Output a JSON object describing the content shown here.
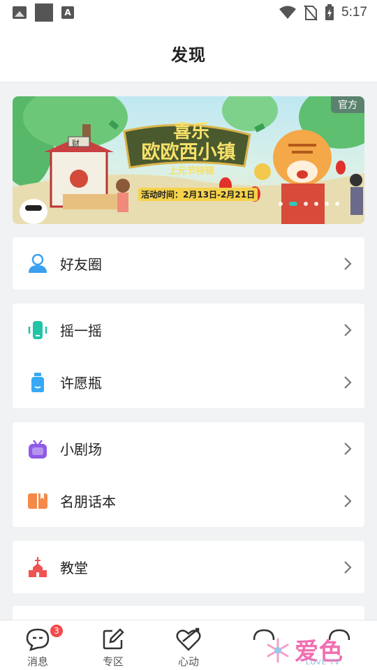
{
  "status_bar": {
    "time": "5:17",
    "icons": [
      "image-icon",
      "square-icon",
      "a-icon",
      "wifi-icon",
      "no-sim-icon",
      "battery-charging-icon"
    ]
  },
  "header": {
    "title": "发现"
  },
  "banner": {
    "badge": "官方",
    "title_line1": "喜乐",
    "title_line2": "欧欧西小镇",
    "subtitle": "上元节特辑",
    "activity_time": "活动时间：2月13日-2月21日",
    "sign": "财",
    "dot_count": 6,
    "active_dot": 1
  },
  "menu_groups": [
    {
      "items": [
        {
          "label": "好友圈",
          "icon": "friends-circle-icon",
          "color": "#3aa0f0"
        }
      ]
    },
    {
      "items": [
        {
          "label": "摇一摇",
          "icon": "shake-phone-icon",
          "color": "#22c4a8"
        },
        {
          "label": "许愿瓶",
          "icon": "wish-bottle-icon",
          "color": "#35a9f5"
        }
      ]
    },
    {
      "items": [
        {
          "label": "小剧场",
          "icon": "theater-tv-icon",
          "color": "#8f5ae8"
        },
        {
          "label": "名朋话本",
          "icon": "book-icon",
          "color": "#f5894a"
        }
      ]
    },
    {
      "items": [
        {
          "label": "教堂",
          "icon": "church-icon",
          "color": "#f15252"
        }
      ]
    }
  ],
  "bottom_nav": [
    {
      "label": "消息",
      "icon": "message-icon",
      "badge": "3"
    },
    {
      "label": "专区",
      "icon": "edit-square-icon"
    },
    {
      "label": "心动",
      "icon": "heart-arrow-icon"
    }
  ],
  "watermark": {
    "text": "爱色",
    "sub": "LOVE TV"
  }
}
